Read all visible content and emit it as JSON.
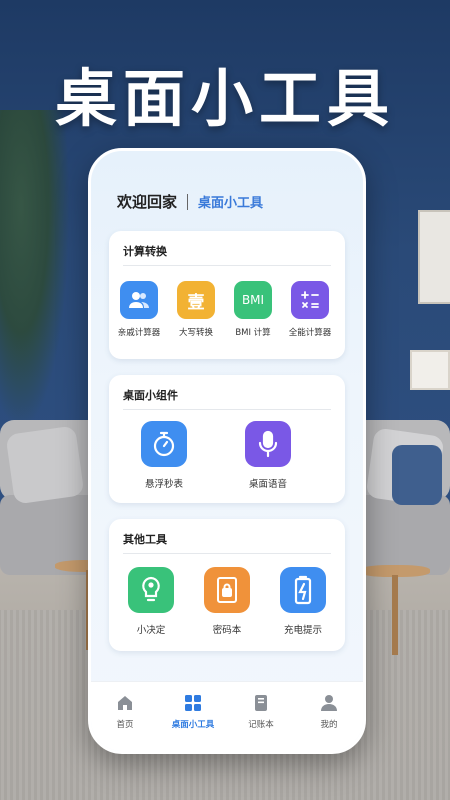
{
  "headline": "桌面小工具",
  "header": {
    "greeting": "欢迎回家",
    "brand": "桌面小工具"
  },
  "sections": [
    {
      "title": "计算转换",
      "tools": [
        {
          "label": "亲戚计算器",
          "icon": "people-icon",
          "color": "#3f8ef0"
        },
        {
          "label": "大写转换",
          "icon_text": "壹",
          "color": "#f2b233"
        },
        {
          "label": "BMI 计算",
          "icon_text": "BMI",
          "color": "#39c27a"
        },
        {
          "label": "全能计算器",
          "icon": "calculator-icon",
          "color": "#7a58e6"
        }
      ]
    },
    {
      "title": "桌面小组件",
      "tools": [
        {
          "label": "悬浮秒表",
          "icon": "stopwatch-icon",
          "color": "#3f8ef0"
        },
        {
          "label": "桌面语音",
          "icon": "microphone-icon",
          "color": "#7a58e6"
        }
      ]
    },
    {
      "title": "其他工具",
      "tools": [
        {
          "label": "小决定",
          "icon": "lightbulb-icon",
          "color": "#39c27a"
        },
        {
          "label": "密码本",
          "icon": "lock-book-icon",
          "color": "#f0923a"
        },
        {
          "label": "充电提示",
          "icon": "battery-icon",
          "color": "#3f8ef0"
        }
      ]
    }
  ],
  "nav": [
    {
      "label": "首页",
      "icon": "home-icon",
      "active": false
    },
    {
      "label": "桌面小工具",
      "icon": "grid-icon",
      "active": true
    },
    {
      "label": "记账本",
      "icon": "notebook-icon",
      "active": false
    },
    {
      "label": "我的",
      "icon": "person-icon",
      "active": false
    }
  ]
}
